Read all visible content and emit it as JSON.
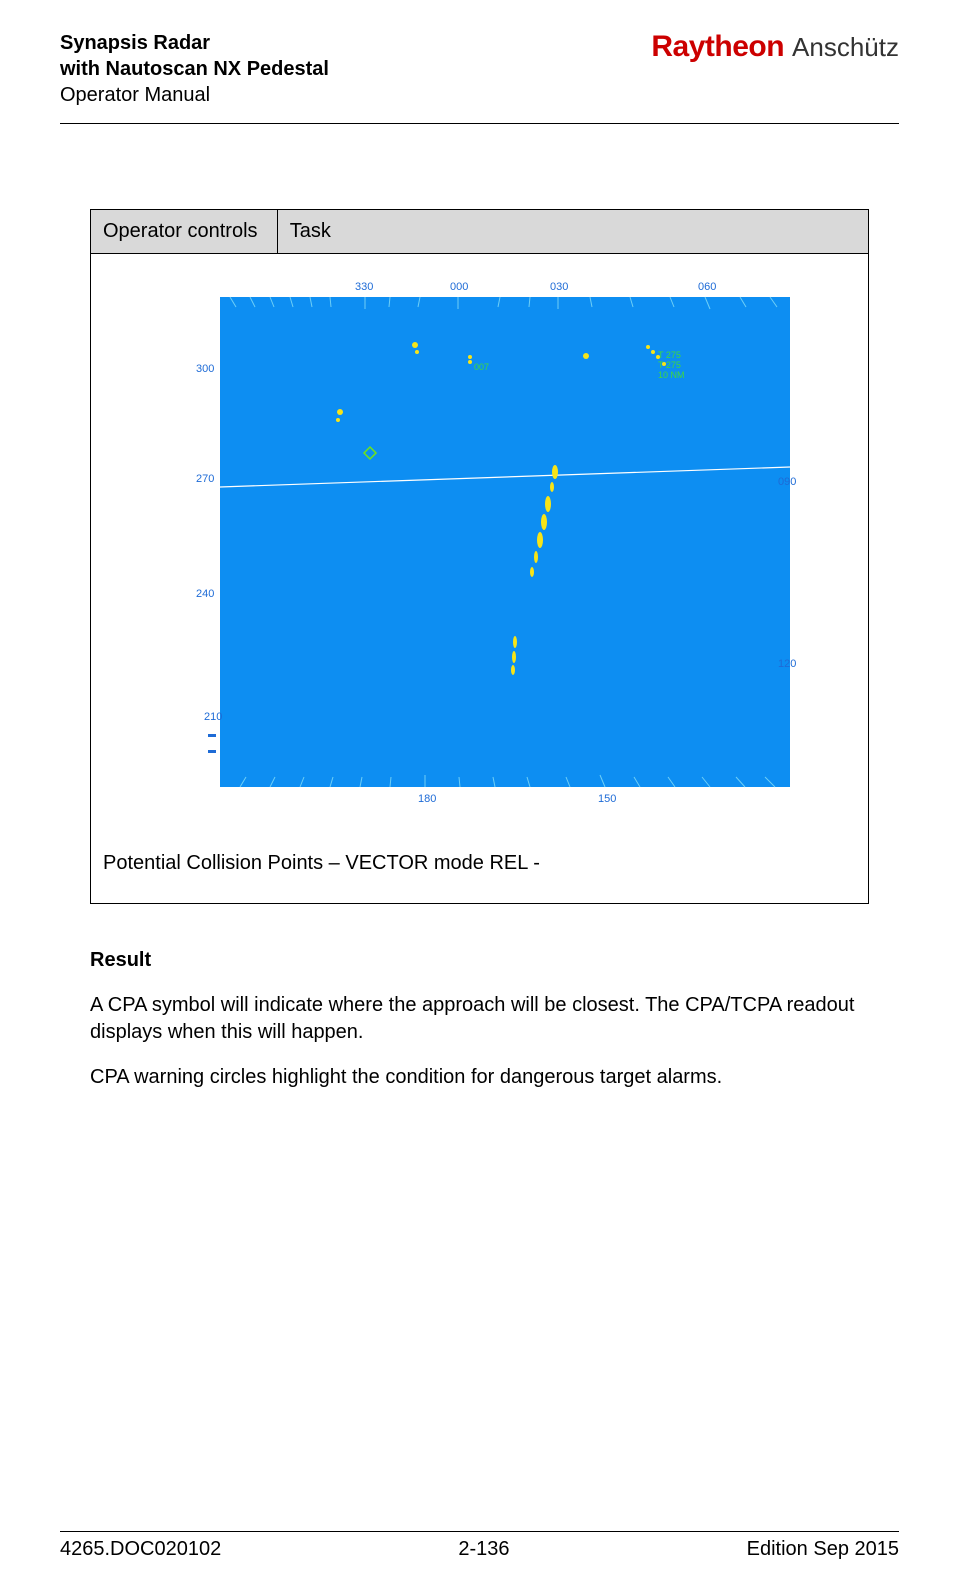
{
  "header": {
    "title_line1": "Synapsis Radar",
    "title_line2": "with Nautoscan NX Pedestal",
    "title_line3": "Operator Manual",
    "brand_left": "Raytheon",
    "brand_right": "Anschütz"
  },
  "table": {
    "header_left": "Operator controls",
    "header_right": "Task",
    "caption": "Potential Collision Points – VECTOR mode REL -"
  },
  "radar": {
    "bearings": {
      "b330": "330",
      "b000": "000",
      "b030": "030",
      "b060": "060",
      "b090": "090",
      "b120": "120",
      "b150": "150",
      "b180": "180",
      "b210": "210",
      "b240": "240",
      "b270": "270",
      "b300": "300"
    },
    "target_label_top": "T 275",
    "target_label_bottom": "T 275",
    "target_label_time": "10 NM"
  },
  "result": {
    "heading": "Result",
    "p1": "A CPA symbol will indicate where the approach will be closest. The CPA/TCPA readout displays when this will happen.",
    "p2": "CPA warning circles highlight the condition for dangerous target alarms."
  },
  "footer": {
    "doc_number": "4265.DOC020102",
    "page": "2-136",
    "edition": "Edition Sep 2015"
  }
}
